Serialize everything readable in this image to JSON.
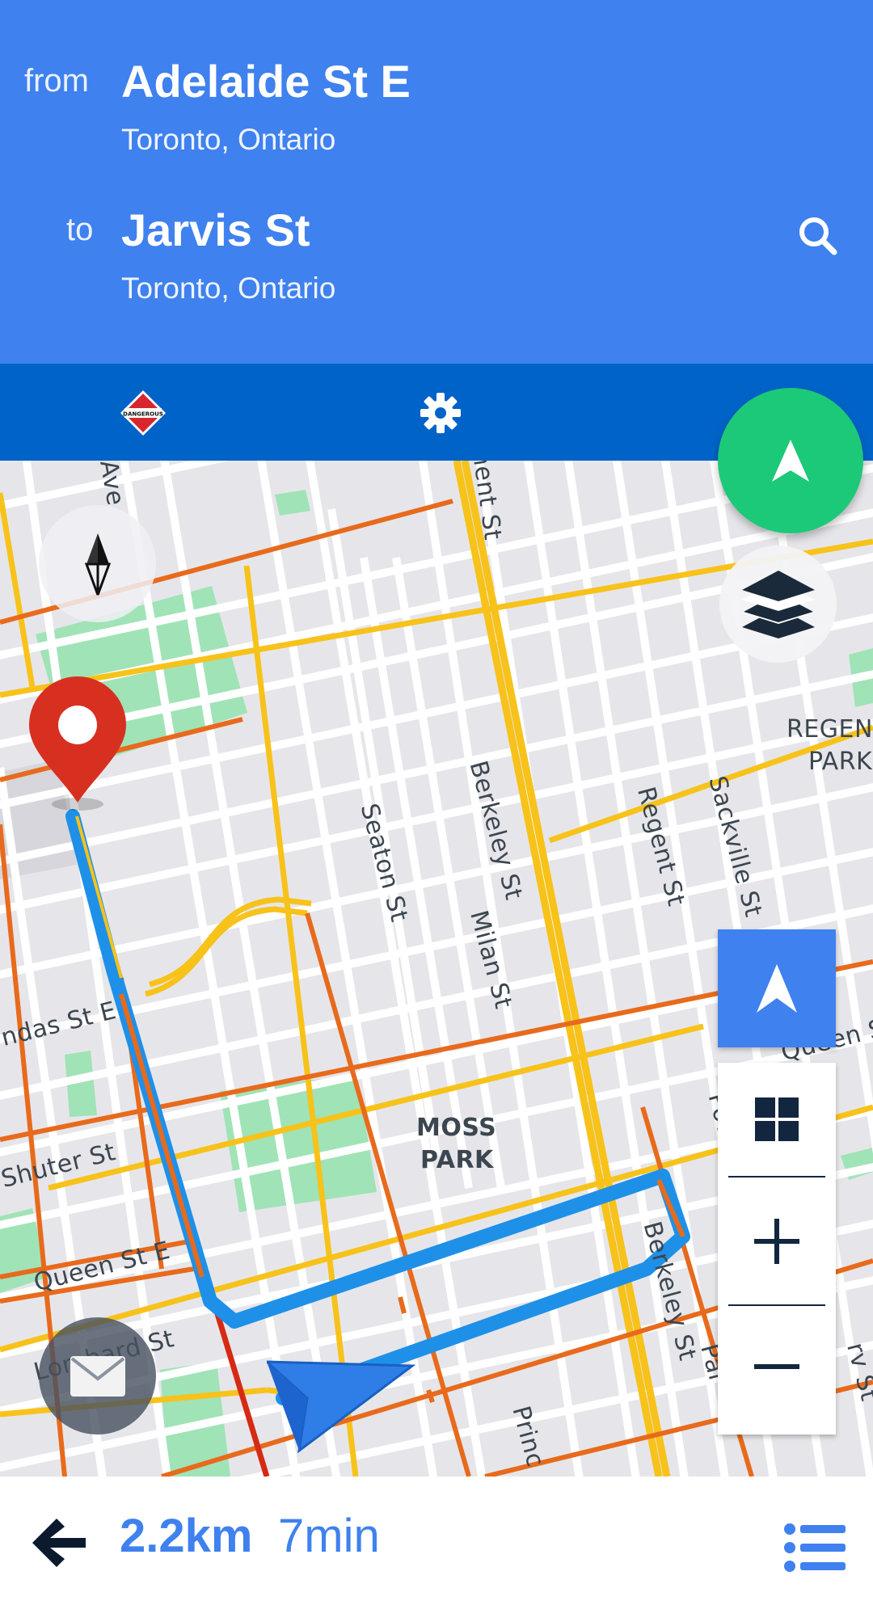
{
  "route": {
    "from_label": "from",
    "from_title": "Adelaide St E",
    "from_subtitle": "Toronto, Ontario",
    "to_label": "to",
    "to_title": "Jarvis St",
    "to_subtitle": "Toronto, Ontario"
  },
  "toolbar": {
    "hazard_badge_text": "DANGEROUS",
    "icons": [
      "dangerous-goods-icon",
      "gear-icon"
    ]
  },
  "map": {
    "labels": {
      "ave": "Ave",
      "ment_st": "ment St",
      "regent_park": "REGENT",
      "regent_park_2": "PARK",
      "seaton": "Seaton St",
      "berkeley_top": "Berkeley St",
      "milan": "Milan St",
      "regent_st": "Regent St",
      "sackville": "Sackville St",
      "dundas": "ndas St E",
      "queen_right": "Queen S",
      "shuter": "Shuter St",
      "moss_park": "MOSS",
      "moss_park_2": "PARK",
      "power": "Power S",
      "queen_left": "Queen St E",
      "berkeley_bottom": "Berkeley St",
      "lombard": "Lombard St",
      "prince": "Princ",
      "parliament": "Par",
      "jarvis_right": "rv St"
    },
    "controls": [
      "compass-icon",
      "layers-icon",
      "navigate-arrow-icon",
      "grid-icon",
      "zoom-in-icon",
      "zoom-out-icon",
      "mail-icon"
    ]
  },
  "bottom_bar": {
    "distance": "2.2km",
    "duration": "7min"
  },
  "colors": {
    "header": "#3f81ee",
    "toolbar": "#0063c8",
    "go_button": "#1cc978",
    "route": "#1e90e8",
    "destination_pin": "#d83020"
  }
}
